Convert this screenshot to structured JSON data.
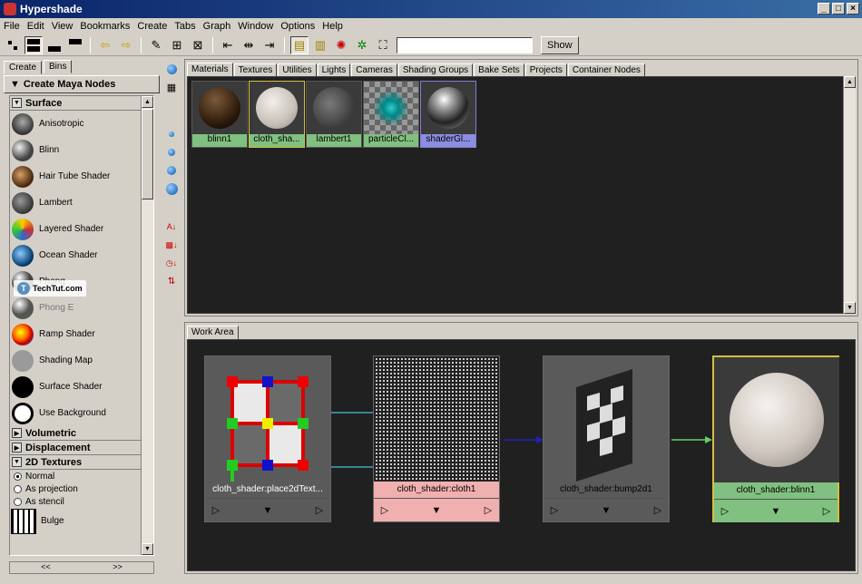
{
  "window": {
    "title": "Hypershade",
    "min": "_",
    "max": "□",
    "close": "×"
  },
  "menu": [
    "File",
    "Edit",
    "View",
    "Bookmarks",
    "Create",
    "Tabs",
    "Graph",
    "Window",
    "Options",
    "Help"
  ],
  "toolbar": {
    "show_label": "Show",
    "show_value": ""
  },
  "left": {
    "tabs": [
      "Create",
      "Bins"
    ],
    "create_title": "Create Maya Nodes",
    "sections": {
      "surface": "Surface",
      "volumetric": "Volumetric",
      "displacement": "Displacement",
      "textures2d": "2D Textures"
    },
    "surface_items": [
      "Anisotropic",
      "Blinn",
      "Hair Tube Shader",
      "Lambert",
      "Layered Shader",
      "Ocean Shader",
      "Phong",
      "Phong E",
      "Ramp Shader",
      "Shading Map",
      "Surface Shader",
      "Use Background"
    ],
    "texture_modes": [
      "Normal",
      "As projection",
      "As stencil"
    ],
    "texture_items": [
      "Bulge"
    ],
    "nav_prev": "<<",
    "nav_next": ">>",
    "watermark": "TechTut.com"
  },
  "top": {
    "tabs": [
      "Materials",
      "Textures",
      "Utilities",
      "Lights",
      "Cameras",
      "Shading Groups",
      "Bake Sets",
      "Projects",
      "Container Nodes"
    ],
    "swatches": [
      "blinn1",
      "cloth_sha...",
      "lambert1",
      "particleCl...",
      "shaderGl..."
    ]
  },
  "work": {
    "tab": "Work Area",
    "nodes": [
      "cloth_shader:place2dText...",
      "cloth_shader:cloth1",
      "cloth_shader:bump2d1",
      "cloth_shader:blinn1"
    ]
  },
  "colors": {
    "accent": "#0a246a",
    "swatch_label_green": "#80c080",
    "node_pink": "#f0b0b0",
    "node_green": "#80c080",
    "selected_border": "#d4c040"
  }
}
